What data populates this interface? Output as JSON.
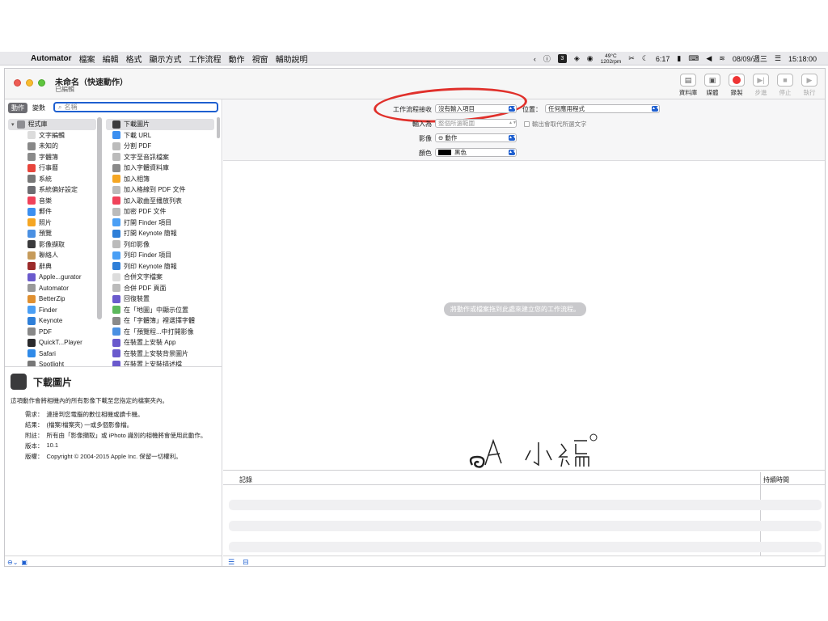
{
  "menubar": {
    "app": "Automator",
    "items": [
      "檔案",
      "編輯",
      "格式",
      "顯示方式",
      "工作流程",
      "動作",
      "視窗",
      "輔助說明"
    ],
    "status": {
      "badge": "3",
      "temp": "49°C",
      "rpm": "1202rpm",
      "time_short": "6:17",
      "date": "08/09/週三",
      "clock": "15:18:00"
    }
  },
  "window": {
    "title": "未命名（快速動作）",
    "subtitle": "已編輯",
    "toolbar": [
      {
        "label": "資料庫",
        "icon": "library-icon",
        "enabled": true
      },
      {
        "label": "媒體",
        "icon": "media-icon",
        "enabled": true
      },
      {
        "label": "錄製",
        "icon": "record-icon",
        "enabled": true
      },
      {
        "label": "步進",
        "icon": "step-icon",
        "enabled": false
      },
      {
        "label": "停止",
        "icon": "stop-icon",
        "enabled": false
      },
      {
        "label": "執行",
        "icon": "run-icon",
        "enabled": false
      }
    ]
  },
  "left": {
    "tabs": [
      "動作",
      "變數"
    ],
    "search_placeholder": "名稱",
    "library_root": "程式庫",
    "library": [
      {
        "label": "文字編輯",
        "color": "#dcdcdc"
      },
      {
        "label": "未知的",
        "color": "#888888"
      },
      {
        "label": "字體簿",
        "color": "#8a8a8a"
      },
      {
        "label": "行事曆",
        "color": "#e8453c"
      },
      {
        "label": "系統",
        "color": "#777777"
      },
      {
        "label": "系統偏好設定",
        "color": "#6d6d72"
      },
      {
        "label": "音樂",
        "color": "#f0425a"
      },
      {
        "label": "郵件",
        "color": "#3b8ff0"
      },
      {
        "label": "照片",
        "color": "#f5a623"
      },
      {
        "label": "預覽",
        "color": "#4a90e2"
      },
      {
        "label": "影像擷取",
        "color": "#3a3a3c"
      },
      {
        "label": "聯絡人",
        "color": "#c69b5b"
      },
      {
        "label": "辭典",
        "color": "#9b2b2b"
      },
      {
        "label": "Apple...gurator",
        "color": "#6a5acd"
      },
      {
        "label": "Automator",
        "color": "#999999"
      },
      {
        "label": "BetterZip",
        "color": "#e09030"
      },
      {
        "label": "Finder",
        "color": "#4a9ff5"
      },
      {
        "label": "Keynote",
        "color": "#2f7fd8"
      },
      {
        "label": "PDF",
        "color": "#888888"
      },
      {
        "label": "QuickT...Player",
        "color": "#2a2a2c"
      },
      {
        "label": "Safari",
        "color": "#2f8ae8"
      },
      {
        "label": "Spotlight",
        "color": "#777777"
      }
    ],
    "actions": [
      {
        "label": "下載圖片",
        "color": "#3a3a3c"
      },
      {
        "label": "下載 URL",
        "color": "#3b8ff0"
      },
      {
        "label": "分割 PDF",
        "color": "#bbbbbb"
      },
      {
        "label": "文字至音訊檔案",
        "color": "#bbbbbb"
      },
      {
        "label": "加入字體資料庫",
        "color": "#8a8a8a"
      },
      {
        "label": "加入相簿",
        "color": "#f5a623"
      },
      {
        "label": "加入格線到 PDF 文件",
        "color": "#bbbbbb"
      },
      {
        "label": "加入歌曲至播放列表",
        "color": "#f0425a"
      },
      {
        "label": "加密 PDF 文件",
        "color": "#bbbbbb"
      },
      {
        "label": "打開 Finder 項目",
        "color": "#4a9ff5"
      },
      {
        "label": "打開 Keynote 簡報",
        "color": "#2f7fd8"
      },
      {
        "label": "列印影像",
        "color": "#bbbbbb"
      },
      {
        "label": "列印 Finder 項目",
        "color": "#4a9ff5"
      },
      {
        "label": "列印 Keynote 簡報",
        "color": "#2f7fd8"
      },
      {
        "label": "合併文字檔案",
        "color": "#dcdcdc"
      },
      {
        "label": "合併 PDF 頁面",
        "color": "#bbbbbb"
      },
      {
        "label": "回復裝置",
        "color": "#6a5acd"
      },
      {
        "label": "在「地圖」中顯示位置",
        "color": "#5cb85c"
      },
      {
        "label": "在「字體簿」裡選擇字體",
        "color": "#8a8a8a"
      },
      {
        "label": "在「預覽程...中打開影像",
        "color": "#4a90e2"
      },
      {
        "label": "在裝置上安裝 App",
        "color": "#6a5acd"
      },
      {
        "label": "在裝置上安裝背景圖片",
        "color": "#6a5acd"
      },
      {
        "label": "在裝置上安裝描述檔",
        "color": "#6a5acd"
      }
    ],
    "desc": {
      "title": "下載圖片",
      "text": "這項動作會將相機內的所有影像下載至您指定的檔案夾內。",
      "rows": [
        {
          "k": "需求：",
          "v": "連接到您電腦的數位相機或讀卡機。"
        },
        {
          "k": "結果：",
          "v": "(檔案/檔案夾) 一或多個影像檔。"
        },
        {
          "k": "附註：",
          "v": "所有由「影像擷取」或 iPhoto 識別的相機將會使用此動作。"
        },
        {
          "k": "版本：",
          "v": "10.1"
        },
        {
          "k": "版權：",
          "v": "Copyright © 2004-2015 Apple Inc. 保留一切權利。"
        }
      ]
    }
  },
  "params": {
    "receives_label": "工作流程接收",
    "receives_value": "沒有輸入項目",
    "in_label": "位置：",
    "in_value": "任何應用程式",
    "input_is_label": "輸入為",
    "input_is_value": "整個所選範圍",
    "replace_label": "輸出會取代所選文字",
    "image_label": "影像",
    "image_value": "⊖ 動作",
    "color_label": "顏色",
    "color_value": "黑色"
  },
  "drop_hint": "將動作或檔案拖到此處來建立您的工作流程。",
  "log": {
    "col1": "記錄",
    "col2": "持續時間"
  }
}
